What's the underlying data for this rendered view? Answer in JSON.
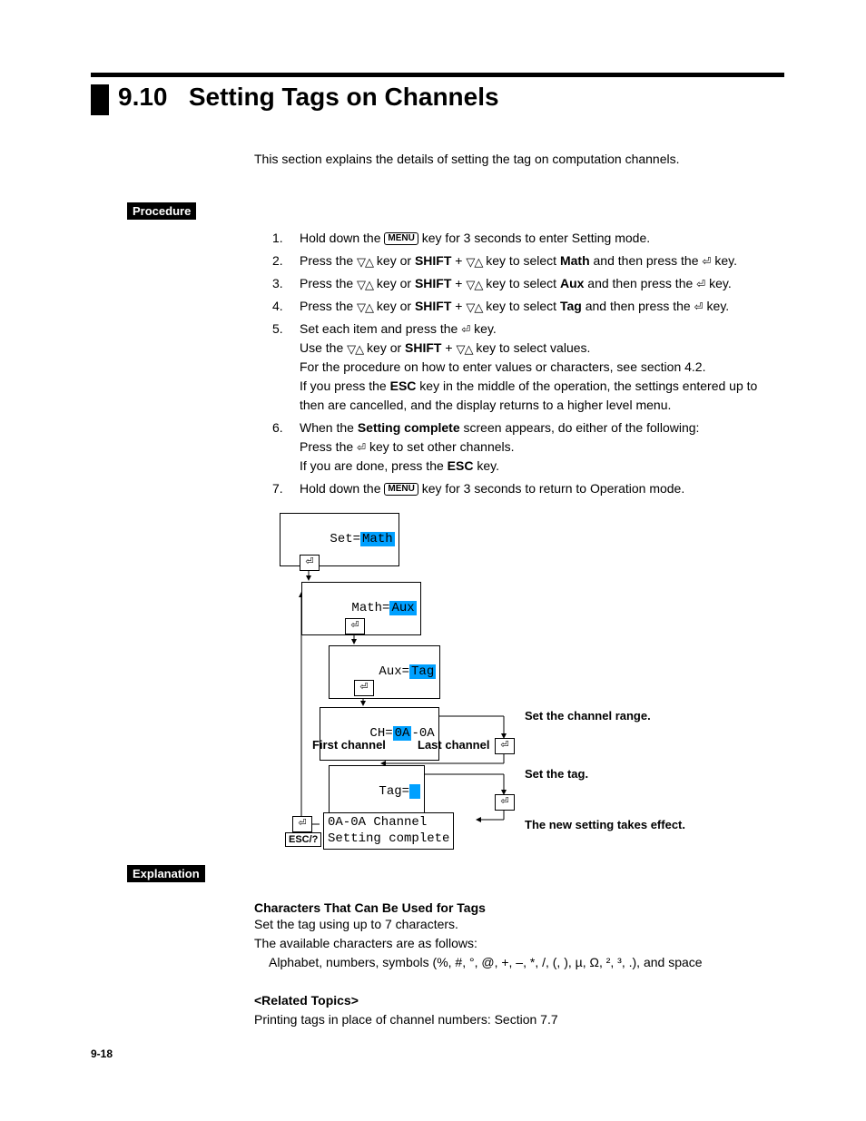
{
  "title": {
    "number": "9.10",
    "text": "Setting Tags on Channels"
  },
  "intro": "This section explains the details of setting the tag on computation channels.",
  "labels": {
    "procedure": "Procedure",
    "explanation": "Explanation"
  },
  "keys": {
    "menu": "MENU",
    "shift": "SHIFT",
    "esc": "ESC",
    "escq": "ESC/?"
  },
  "steps": [
    {
      "n": "1.",
      "pre": "Hold down the ",
      "key": "menu",
      "post": " key for 3 seconds to enter Setting mode."
    },
    {
      "n": "2.",
      "pre": "Press the ",
      "post1": " key or ",
      "post2": " + ",
      "post3": " key to select ",
      "bold": "Math",
      "post4": " and then press the ",
      "tail": " key."
    },
    {
      "n": "3.",
      "pre": "Press the ",
      "post1": " key or ",
      "post2": " + ",
      "post3": " key to select ",
      "bold": "Aux",
      "post4": " and then press the ",
      "tail": " key."
    },
    {
      "n": "4.",
      "pre": "Press the ",
      "post1": " key or ",
      "post2": " + ",
      "post3": " key to select ",
      "bold": "Tag",
      "post4": " and then press the ",
      "tail": " key."
    },
    {
      "n": "5.",
      "l1_pre": "Set each item and press the ",
      "l1_post": " key.",
      "l2_pre": "Use the ",
      "l2_mid1": " key or ",
      "l2_mid2": " + ",
      "l2_post": " key to select values.",
      "l3": "For the procedure on how to enter values or characters, see section 4.2.",
      "l4_pre": "If you press the ",
      "l4_bold": "ESC",
      "l4_post": " key in the middle of the operation, the settings entered up to then are cancelled, and the display returns to a higher level menu."
    },
    {
      "n": "6.",
      "l1_pre": "When the ",
      "l1_bold": "Setting complete",
      "l1_post": " screen appears, do either of the following:",
      "l2_pre": "Press the ",
      "l2_post": " key to set other channels.",
      "l3_pre": "If you are done, press the ",
      "l3_bold": "ESC",
      "l3_post": " key."
    },
    {
      "n": "7.",
      "pre": "Hold down the ",
      "key": "menu",
      "post": " key for 3 seconds to return to Operation mode."
    }
  ],
  "diagram": {
    "set_pre": "Set=",
    "set_hl": "Math",
    "math_pre": "Math=",
    "math_hl": "Aux",
    "aux_pre": "Aux=",
    "aux_hl": "Tag",
    "ch_pre": "CH=",
    "ch_hl": "0A",
    "ch_post": "-0A",
    "tag_pre": "Tag=",
    "complete_l1": "0A-0A Channel",
    "complete_l2": "Setting complete",
    "first": "First channel",
    "last": "Last channel",
    "r1": "Set the channel range.",
    "r2": "Set the tag.",
    "r3": "The new setting takes effect."
  },
  "explanation": {
    "h1": "Characters That Can Be Used for Tags",
    "p1": "Set the tag using up to 7 characters.",
    "p2": "The available characters are as follows:",
    "p3": "Alphabet, numbers, symbols (%, #, °, @, +, –, *, /, (, ), µ, Ω, ², ³, .), and space",
    "h2": "<Related Topics>",
    "p4": "Printing tags in place of channel numbers: Section 7.7"
  },
  "footer": "9-18"
}
